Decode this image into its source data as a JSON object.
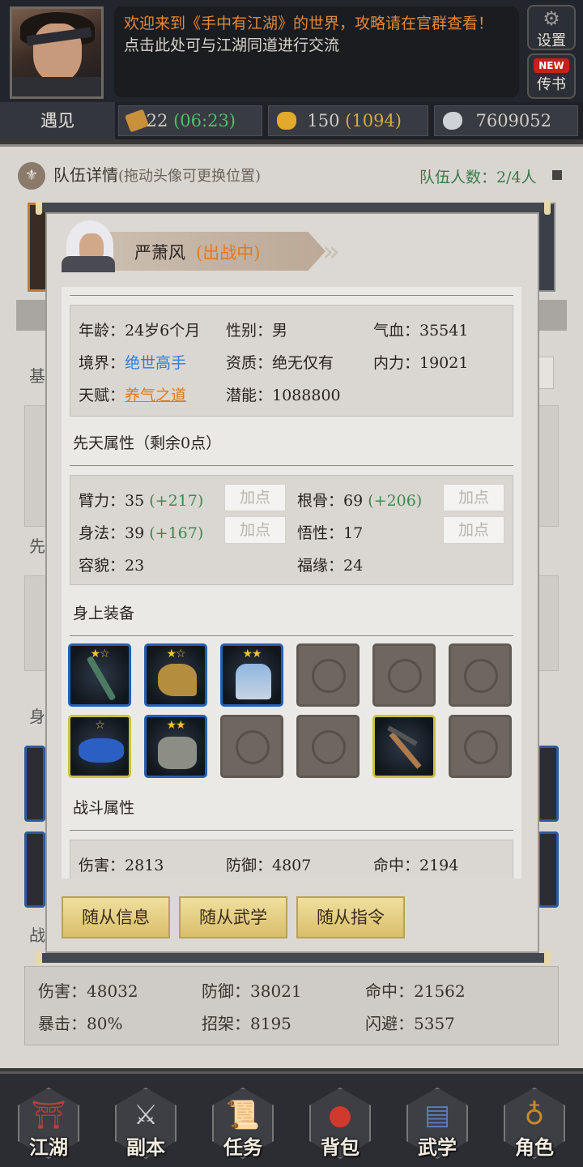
{
  "header": {
    "announce_line1": "欢迎来到《手中有江湖》的世界，攻略请在官群查看！",
    "announce_line2": "点击此处可与江湖同道进行交流",
    "settings_label": "设置",
    "mail_badge": "NEW",
    "mail_label": "传书"
  },
  "resources": {
    "meet_tab": "遇见",
    "stamina": "22",
    "stamina_timer": "(06:23)",
    "gold": "150",
    "gold_extra": "(1094)",
    "silver": "7609052"
  },
  "team": {
    "title": "队伍详情",
    "hint": "(拖动头像可更换位置)",
    "count": "队伍人数：2/4人"
  },
  "background_labels": {
    "ji": "基",
    "xian": "先",
    "shen": "身",
    "zhan": "战"
  },
  "base_stats": {
    "damage": "伤害：48032",
    "defense": "防御：38021",
    "hit": "命中：21562",
    "crit": "暴击：80%",
    "parry": "招架：8195",
    "dodge": "闪避：5357"
  },
  "modal": {
    "name": "严萧风",
    "status": "(出战中)",
    "info": {
      "age": "年龄：24岁6个月",
      "gender": "性别：男",
      "hp": "气血：35541",
      "realm_label": "境界：",
      "realm_value": "绝世高手",
      "aptitude": "资质：绝无仅有",
      "mp": "内力：19021",
      "talent_label": "天赋：",
      "talent_value": "养气之道",
      "potential": "潜能：1088800"
    },
    "innate_title": "先天属性（剩余0点）",
    "attrs": {
      "strength": "臂力：35",
      "strength_bonus": "(+217)",
      "bone": "根骨：69",
      "bone_bonus": "(+206)",
      "agility": "身法：39",
      "agility_bonus": "(+167)",
      "insight": "悟性：17",
      "looks": "容貌：23",
      "luck": "福缘：24",
      "add_label": "加点"
    },
    "equip_title": "身上装备",
    "equip_stars": [
      "★☆",
      "★☆",
      "★★",
      "",
      "",
      "",
      "☆",
      "★★",
      "",
      "",
      "",
      ""
    ],
    "combat_title": "战斗属性",
    "combat": {
      "damage": "伤害：2813",
      "defense": "防御：4807",
      "hit": "命中：2194"
    },
    "buttons": {
      "info": "随从信息",
      "skills": "随从武学",
      "command": "随从指令"
    }
  },
  "nav": {
    "jianghu": "江湖",
    "dungeon": "副本",
    "quest": "任务",
    "bag": "背包",
    "martial": "武学",
    "character": "角色"
  },
  "colors": {
    "accent_orange": "#e07a1a",
    "green": "#4fbe6b",
    "blue": "#2c7ed4",
    "gold": "#d9a941"
  }
}
